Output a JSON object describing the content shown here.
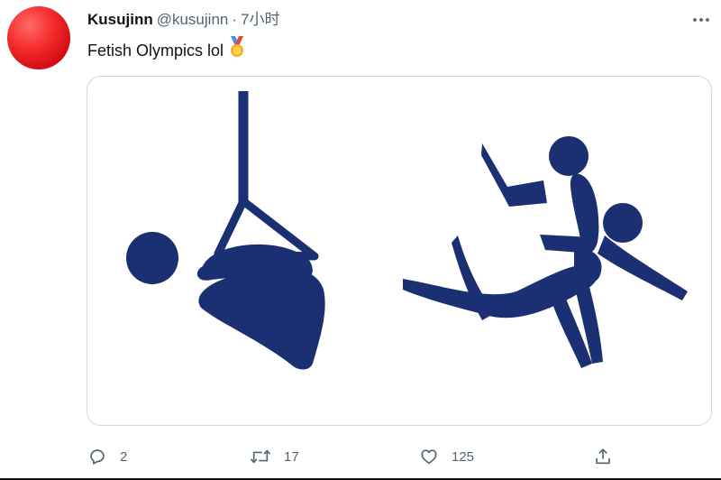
{
  "tweet": {
    "display_name": "Kusujinn",
    "handle": "@kusujinn",
    "separator": "·",
    "timestamp": "7小时",
    "text": "Fetish Olympics lol",
    "text_emoji": "medal-icon",
    "avatar_color": "#e8141b"
  },
  "media": {
    "pictogram_color": "#1b2f73",
    "left_pictogram": "suspended-figure-icon",
    "right_pictogram": "judo-throw-icon"
  },
  "actions": {
    "reply_count": "2",
    "retweet_count": "17",
    "like_count": "125"
  },
  "colors": {
    "text_primary": "#0f1419",
    "text_secondary": "#536471",
    "border": "#cfd9de"
  }
}
